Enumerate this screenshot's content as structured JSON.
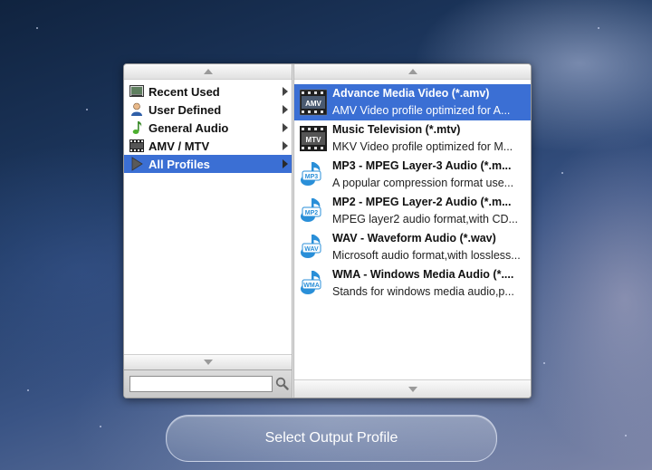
{
  "categories": [
    {
      "label": "Recent Used",
      "icon": "recent-used-icon",
      "selected": false
    },
    {
      "label": "User Defined",
      "icon": "user-icon",
      "selected": false
    },
    {
      "label": "General Audio",
      "icon": "music-note-icon",
      "selected": false
    },
    {
      "label": "AMV / MTV",
      "icon": "film-icon",
      "selected": false
    },
    {
      "label": "All Profiles",
      "icon": "play-icon",
      "selected": true
    }
  ],
  "profiles": [
    {
      "name": "Advance Media Video (*.amv)",
      "desc": "AMV Video profile optimized for A...",
      "icon_text": "AMV",
      "icon": "amv-film-icon",
      "selected": true
    },
    {
      "name": "Music Television (*.mtv)",
      "desc": "MKV Video profile optimized for M...",
      "icon_text": "MTV",
      "icon": "mtv-film-icon",
      "selected": false
    },
    {
      "name": "MP3 - MPEG Layer-3 Audio (*.m...",
      "desc": "A popular compression format use...",
      "icon_text": "MP3",
      "icon": "mp3-audio-icon",
      "selected": false
    },
    {
      "name": "MP2 - MPEG Layer-2 Audio (*.m...",
      "desc": "MPEG layer2 audio format,with CD...",
      "icon_text": "MP2",
      "icon": "mp2-audio-icon",
      "selected": false
    },
    {
      "name": "WAV - Waveform Audio (*.wav)",
      "desc": "Microsoft audio format,with lossless...",
      "icon_text": "WAV",
      "icon": "wav-audio-icon",
      "selected": false
    },
    {
      "name": "WMA - Windows Media Audio (*....",
      "desc": "Stands for windows media audio,p...",
      "icon_text": "WMA",
      "icon": "wma-audio-icon",
      "selected": false
    }
  ],
  "search": {
    "value": "",
    "placeholder": ""
  },
  "select_button": {
    "label": "Select Output Profile"
  },
  "colors": {
    "selection": "#3b6fd4",
    "audio_icon": "#2a8fd8"
  }
}
